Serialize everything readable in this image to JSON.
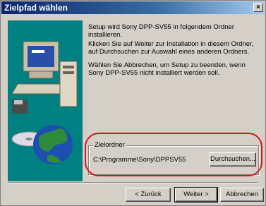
{
  "window": {
    "title": "Zielpfad wählen",
    "close_label": "×"
  },
  "content": {
    "paragraph1": "Setup wird Sony DPP-SV55 in folgendem Ordner installieren.",
    "paragraph2": "Klicken Sie auf Weiter zur Installation in diesem Ordner, auf Durchsuchen zur Auswahl eines anderen Ordners.",
    "paragraph3": "Wählen Sie Abbrechen, um Setup zu beenden, wenn Sony DPP-SV55 nicht installiert werden soll."
  },
  "destination": {
    "group_label": "Zielordner",
    "path": "C:\\Programme\\Sony\\DPPSV55",
    "browse_label": "Durchsuchen..."
  },
  "buttons": {
    "back_label": "< Zurück",
    "next_label": "Weiter >",
    "cancel_label": "Abbrechen"
  },
  "colors": {
    "titlebar_start": "#0a246a",
    "titlebar_end": "#a6caf0",
    "dialog_bg": "#d4d0c8",
    "highlight_ellipse": "#e0101a",
    "artwork_bg": "#008080"
  }
}
